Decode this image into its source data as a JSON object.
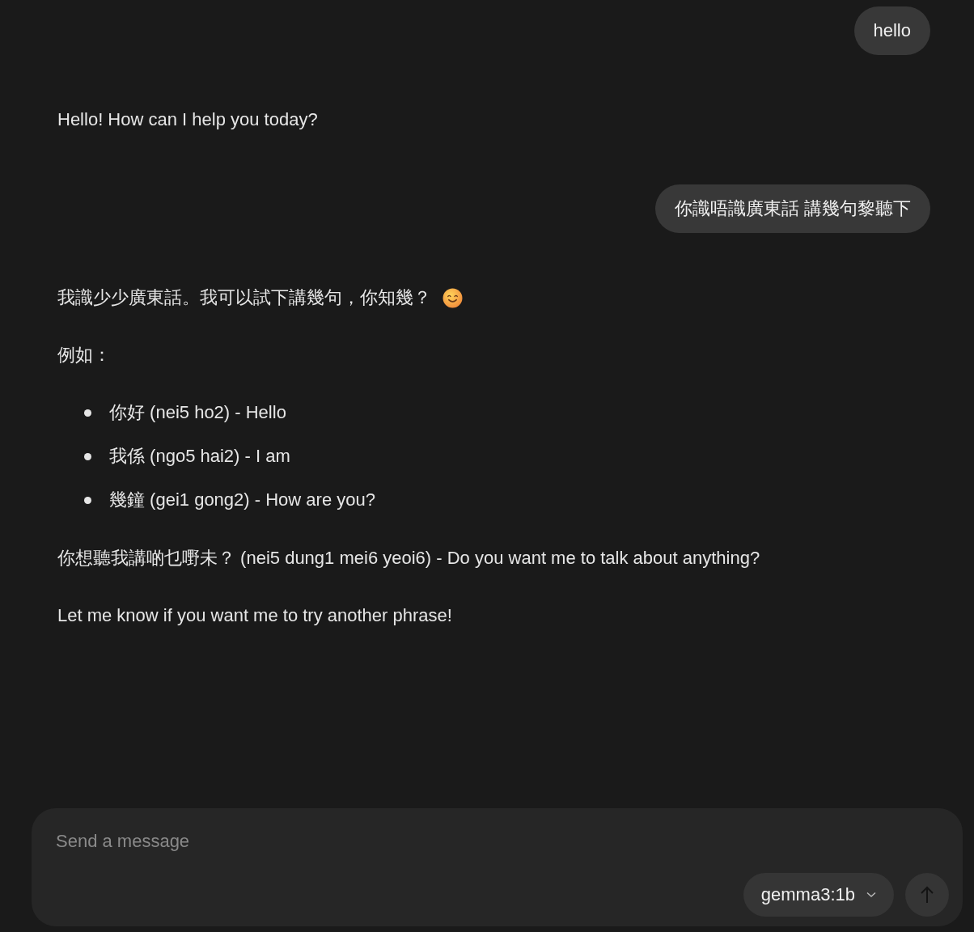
{
  "messages": [
    {
      "kind": "user",
      "text": "hello"
    },
    {
      "kind": "assistant",
      "blocks": [
        {
          "kind": "paragraph",
          "text": "Hello! How can I help you today?"
        }
      ]
    },
    {
      "kind": "user",
      "text": "你識唔識廣東話 講幾句黎聽下"
    },
    {
      "kind": "assistant",
      "blocks": [
        {
          "kind": "paragraph",
          "text": "我識少少廣東話。我可以試下講幾句，你知幾？",
          "emoji": true
        },
        {
          "kind": "paragraph",
          "text": "例如："
        },
        {
          "kind": "list",
          "items": [
            "你好 (nei5 ho2) - Hello",
            "我係 (ngo5 hai2) - I am",
            "幾鐘 (gei1 gong2) - How are you?"
          ]
        },
        {
          "kind": "paragraph",
          "text": "你想聽我講啲乜嘢未？ (nei5 dung1 mei6 yeoi6) - Do you want me to talk about anything?"
        },
        {
          "kind": "paragraph",
          "text": "Let me know if you want me to try another phrase!"
        }
      ]
    }
  ],
  "composer": {
    "placeholder": "Send a message",
    "model": "gemma3:1b"
  }
}
